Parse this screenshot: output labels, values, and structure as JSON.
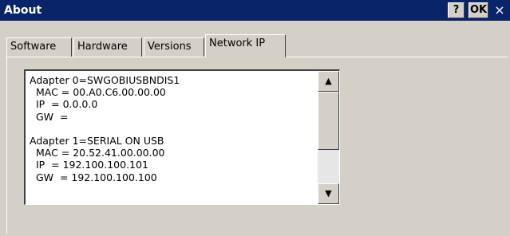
{
  "window": {
    "title": "About",
    "help_label": "?",
    "ok_label": "OK",
    "close_glyph": "×"
  },
  "tabs": [
    {
      "label": "Software"
    },
    {
      "label": "Hardware"
    },
    {
      "label": "Versions"
    },
    {
      "label": "Network IP",
      "active": true
    }
  ],
  "network": {
    "lines": [
      "Adapter 0=SWGOBIUSBNDIS1",
      "  MAC = 00.A0.C6.00.00.00",
      "  IP  = 0.0.0.0",
      "  GW  =",
      "",
      "Adapter 1=SERIAL ON USB",
      "  MAC = 20.52.41.00.00.00",
      "  IP  = 192.100.100.101",
      "  GW  = 192.100.100.100"
    ]
  },
  "scrollbar": {
    "up_glyph": "▲",
    "down_glyph": "▼"
  }
}
